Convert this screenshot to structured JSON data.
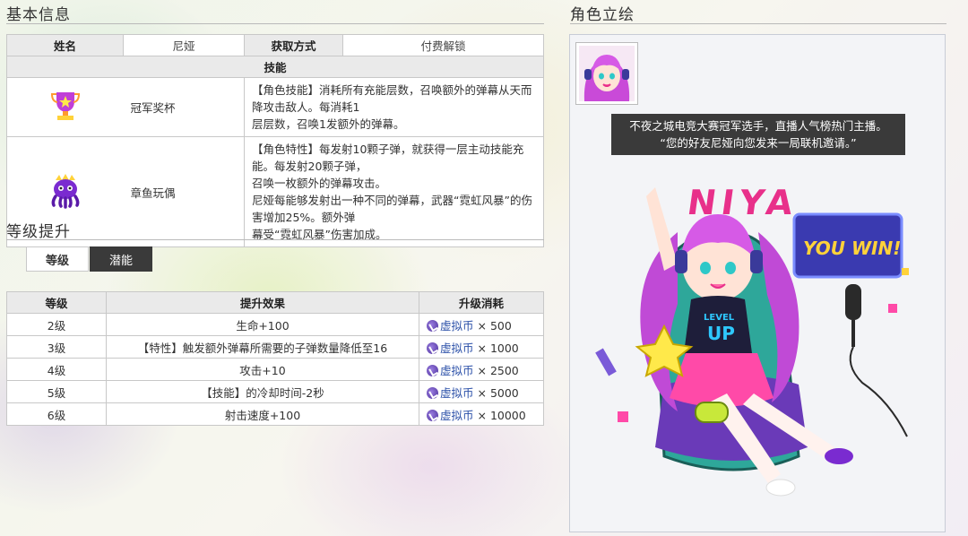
{
  "sections": {
    "basic_info": "基本信息",
    "level_up": "等级提升",
    "portrait": "角色立绘"
  },
  "info": {
    "name_label": "姓名",
    "name_value": "尼娅",
    "obtain_label": "获取方式",
    "obtain_value": "付费解锁",
    "skills_label": "技能",
    "skills": [
      {
        "name": "冠军奖杯",
        "icon": "trophy-icon",
        "lines": [
          "【角色技能】消耗所有充能层数，召唤额外的弹幕从天而降攻击敌人。每消耗1",
          "层层数，召唤1发额外的弹幕。"
        ]
      },
      {
        "name": "章鱼玩偶",
        "icon": "octopus-doll-icon",
        "lines": [
          "【角色特性】每发射10颗子弹，就获得一层主动技能充能。每发射20颗子弹，",
          "召唤一枚额外的弹幕攻击。",
          "尼娅每能够发射出一种不同的弹幕，武器“霓虹风暴”的伤害增加25%。额外弹",
          "幕受“霓虹风暴”伤害加成。"
        ]
      }
    ]
  },
  "tabs": {
    "level": "等级",
    "potential": "潜能"
  },
  "level_table": {
    "headers": [
      "等级",
      "提升效果",
      "升级消耗"
    ],
    "currency": "虚拟币",
    "rows": [
      {
        "level": "2级",
        "effect": "生命+100",
        "cost": "× 500"
      },
      {
        "level": "3级",
        "effect": "【特性】触发额外弹幕所需要的子弹数量降低至16",
        "cost": "× 1000"
      },
      {
        "level": "4级",
        "effect": "攻击+10",
        "cost": "× 2500"
      },
      {
        "level": "5级",
        "effect": "【技能】的冷却时间-2秒",
        "cost": "× 5000"
      },
      {
        "level": "6级",
        "effect": "射击速度+100",
        "cost": "× 10000"
      }
    ]
  },
  "portrait": {
    "quote_line1": "不夜之城电竞大赛冠军选手，直播人气榜热门主播。",
    "quote_line2": "“您的好友尼娅向您发来一局联机邀请。”",
    "art_title": "NIYA",
    "sign_text": "YOU WIN!",
    "shirt_text1": "LEVEL",
    "shirt_text2": "UP"
  },
  "colors": {
    "header_bg": "#eaeaea",
    "tab_dark": "#3a3a3a",
    "quote_bg": "#3a3a3a",
    "hair_purple": "#c04ad6",
    "accent_pink": "#e8308a",
    "neon_blue": "#3a5fd6"
  }
}
